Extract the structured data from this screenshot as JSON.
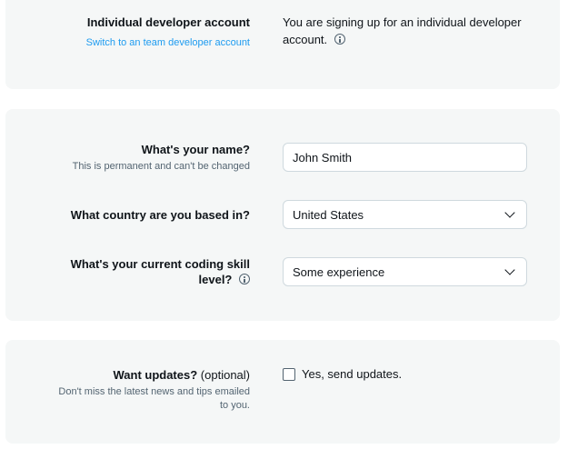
{
  "account": {
    "title": "Individual developer account",
    "switch_link": "Switch to an team developer account",
    "description_line1": "You are signing up for an individual developer",
    "description_line2": "account."
  },
  "profile": {
    "name_label": "What's your name?",
    "name_sublabel": "This is permanent and can't be changed",
    "name_value": "John Smith",
    "country_label": "What country are you based in?",
    "country_value": "United States",
    "skill_label_line1": "What's your current coding skill",
    "skill_label_line2": "level?",
    "skill_value": "Some experience"
  },
  "updates": {
    "label": "Want updates?",
    "optional": "(optional)",
    "sublabel_line1": "Don't miss the latest news and tips emailed",
    "sublabel_line2": "to you.",
    "checkbox_label": "Yes, send updates.",
    "checked": false
  },
  "icons": {
    "info": "info-icon",
    "chevron": "chevron-down-icon",
    "checkbox": "checkbox-icon"
  },
  "colors": {
    "link": "#1d9bf0",
    "card_bg": "#f5f7f7",
    "muted_text": "#536471"
  }
}
